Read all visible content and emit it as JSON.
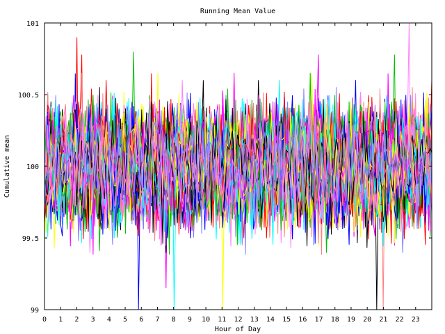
{
  "chart_data": {
    "type": "line",
    "title": "Running Mean Value",
    "xlabel": "Hour of Day",
    "ylabel": "Cumulative mean",
    "xlim": [
      0,
      24
    ],
    "ylim": [
      99,
      101
    ],
    "x_ticks": [
      0,
      1,
      2,
      3,
      4,
      5,
      6,
      7,
      8,
      9,
      10,
      11,
      12,
      13,
      14,
      15,
      16,
      17,
      18,
      19,
      20,
      21,
      22,
      23
    ],
    "x_tick_labels": [
      "0",
      "1",
      "2",
      "3",
      "4",
      "5",
      "6",
      "7",
      "8",
      "9",
      "10",
      "11",
      "12",
      "13",
      "14",
      "15",
      "16",
      "17",
      "18",
      "19",
      "20",
      "21",
      "22",
      "23"
    ],
    "y_ticks": [
      99,
      99.5,
      100,
      100.5,
      101
    ],
    "y_tick_labels": [
      "99",
      "99.5",
      "100",
      "100.5",
      "101"
    ],
    "grid": false,
    "legend": "none",
    "series_count": 80,
    "points_per_series": 240,
    "series_center": 100,
    "series_typical_range": [
      99.6,
      100.4
    ],
    "series_extreme_range": [
      99,
      101
    ],
    "series_colors": [
      "#ff0000",
      "#00c000",
      "#0000ff",
      "#ff00ff",
      "#00ffff",
      "#ffff00",
      "#000000",
      "#ff8080",
      "#ff80ff",
      "#8080ff"
    ],
    "notable_points": [
      {
        "x": 2.0,
        "y": 100.9
      },
      {
        "x": 5.5,
        "y": 100.8
      },
      {
        "x": 5.8,
        "y": 99.0
      },
      {
        "x": 7.5,
        "y": 99.15
      },
      {
        "x": 8.0,
        "y": 99.0
      },
      {
        "x": 11.0,
        "y": 99.0
      },
      {
        "x": 20.6,
        "y": 99.0
      },
      {
        "x": 21.0,
        "y": 99.0
      },
      {
        "x": 22.6,
        "y": 101.0
      }
    ]
  }
}
